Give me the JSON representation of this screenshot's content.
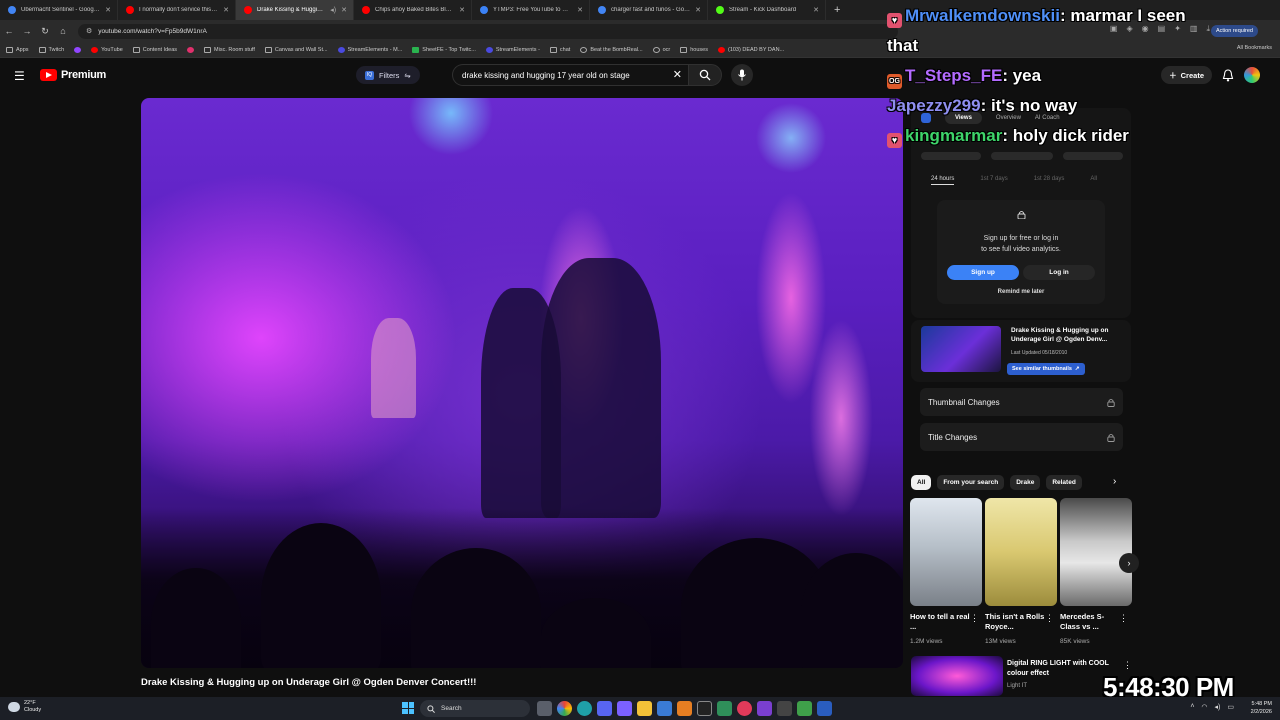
{
  "browser": {
    "tabs": [
      {
        "label": "Übermacht Sentinel - Google S",
        "color": "#4285f4",
        "active": false
      },
      {
        "label": "I normally don't service this an",
        "color": "#ff0000",
        "active": false
      },
      {
        "label": "Drake Kissing & Hugging u",
        "color": "#ff0000",
        "active": true
      },
      {
        "label": "Chips ahoy Baked Bites Blondie",
        "color": "#ff0000",
        "active": false
      },
      {
        "label": "YTMP3: Free YouTube to MP3 C",
        "color": "#3b82f6",
        "active": false
      },
      {
        "label": "charger fast and furios - Googl",
        "color": "#4285f4",
        "active": false
      },
      {
        "label": "Stream - Kick Dashboard",
        "color": "#53fc18",
        "active": false
      }
    ],
    "url": "youtube.com/watch?v=Fp5b9dW1nrA",
    "action_required": "Action required",
    "gemini_label": "Gemini",
    "bookmarks": [
      "Apps",
      "Twitch",
      "",
      "YouTube",
      "Content Ideas",
      "",
      "Misc. Room stuff",
      "Canvas and Wall St...",
      "StreamElements - M...",
      "SheetFE - Top Twitc...",
      "StreamElements -",
      "chat",
      "Beat the BombReal...",
      "ocr",
      "houses",
      "(103) DEAD BY DAN..."
    ],
    "all_bookmarks": "All Bookmarks"
  },
  "youtube": {
    "logo_text": "Premium",
    "filters_label": "Filters",
    "search_query": "drake kissing and hugging 17 year old on stage",
    "create_label": "Create",
    "video_title": "Drake Kissing & Hugging up on Underage Girl @ Ogden Denver Concert!!!"
  },
  "analytics": {
    "tabs": [
      "Views",
      "Overview",
      "AI Coach"
    ],
    "ranges": [
      "24 hours",
      "1st 7 days",
      "1st 28 days",
      "All"
    ],
    "signup_line1": "Sign up for free or log in",
    "signup_line2": "to see full video analytics.",
    "signup_button": "Sign up",
    "login_button": "Log in",
    "remind_later": "Remind me later",
    "thumb_title": "Drake Kissing & Hugging up on Underage Girl @ Ogden Denv...",
    "thumb_updated": "Last Updated 05/18/2010",
    "similar_thumbnails": "See similar thumbnails",
    "thumbnail_changes": "Thumbnail Changes",
    "title_changes": "Title Changes"
  },
  "chips": [
    "All",
    "From your search",
    "Drake",
    "Related"
  ],
  "shorts": [
    {
      "title": "How to tell a real ...",
      "views": "1.2M views"
    },
    {
      "title": "This isn't a Rolls Royce...",
      "views": "13M views"
    },
    {
      "title": "Mercedes S-Class vs ...",
      "views": "85K views"
    }
  ],
  "recommendation": {
    "title": "Digital RING LIGHT with COOL colour effect",
    "channel": "Light IT"
  },
  "overlay_chat": [
    {
      "user": "Mrwalkemdownskii",
      "text": ": marmar I seen",
      "cont": "that",
      "user_color": "#4f8ff7",
      "badge": "heart"
    },
    {
      "user": "T_Steps_FE",
      "text": ": yea",
      "user_color": "#b36bff",
      "badge": "og"
    },
    {
      "user": "Japezzy299",
      "text": ": it's no way",
      "user_color": "#8f8ff0",
      "badge": ""
    },
    {
      "user": "kingmarmar",
      "text": ": holy dick rider",
      "user_color": "#3ed46a",
      "badge": "heart"
    }
  ],
  "overlay_clock": "5:48:30 PM",
  "taskbar": {
    "temperature": "22°F",
    "weather": "Cloudy",
    "search_label": "Search",
    "time": "5:48 PM",
    "date": "2/2/2026"
  }
}
